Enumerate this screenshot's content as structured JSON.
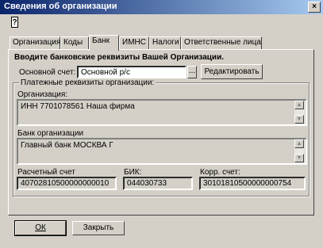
{
  "window": {
    "title": "Сведения об организации",
    "close_label": "×",
    "help_label": "?"
  },
  "tabs": [
    {
      "label": "Организация"
    },
    {
      "label": "Коды"
    },
    {
      "label": "Банк"
    },
    {
      "label": "ИМНС"
    },
    {
      "label": "Налоги"
    },
    {
      "label": "Ответственные лица"
    }
  ],
  "bank": {
    "heading": "Вводите банковские реквизиты Вашей Организации.",
    "account_label": "Основной счет:",
    "account_value": "Основной р/с",
    "browse_label": "...",
    "edit_label": "Редактировать",
    "group_label": "Платежные реквизиты организации:",
    "org_label": "Организация:",
    "org_value": "ИНН 7701078561 Наша фирма",
    "bank_label": "Банк организации",
    "bank_value": "Главный банк МОСКВА Г",
    "settlement_label": "Расчетный счет",
    "settlement_value": "40702810500000000010",
    "bik_label": "БИК:",
    "bik_value": "044030733",
    "corr_label": "Корр. счет:",
    "corr_value": "30101810500000000754"
  },
  "footer": {
    "ok_label": "ОК",
    "close_label": "Закрыть"
  }
}
